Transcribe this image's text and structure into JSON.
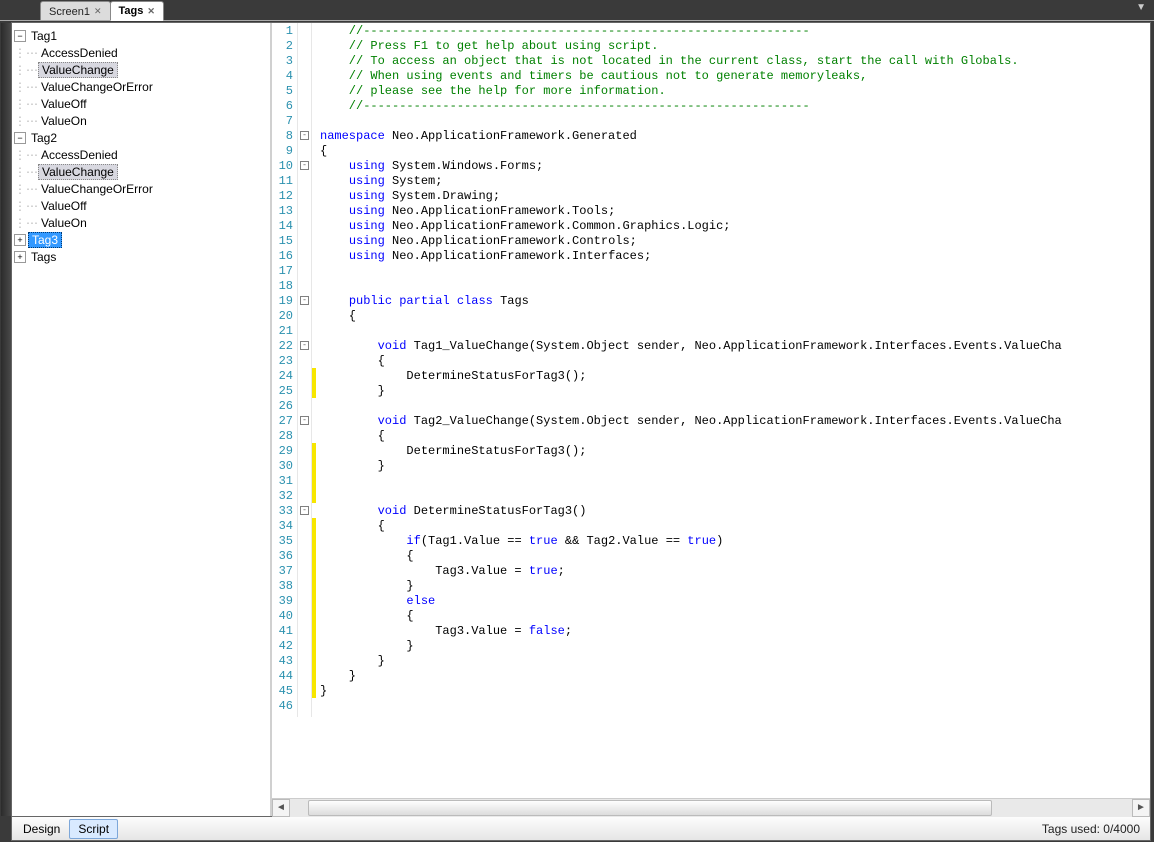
{
  "doc_tabs": {
    "inactive": "Screen1",
    "active": "Tags"
  },
  "tree": {
    "tag1": {
      "name": "Tag1",
      "children": [
        "AccessDenied",
        "ValueChange",
        "ValueChangeOrError",
        "ValueOff",
        "ValueOn"
      ]
    },
    "tag2": {
      "name": "Tag2",
      "children": [
        "AccessDenied",
        "ValueChange",
        "ValueChangeOrError",
        "ValueOff",
        "ValueOn"
      ]
    },
    "tag3": {
      "name": "Tag3"
    },
    "tags": {
      "name": "Tags"
    }
  },
  "bottom": {
    "design": "Design",
    "script": "Script",
    "status": "Tags used: 0/4000"
  },
  "code": {
    "lines": [
      {
        "n": 1,
        "cls": "cm",
        "text": "    //--------------------------------------------------------------"
      },
      {
        "n": 2,
        "cls": "cm",
        "text": "    // Press F1 to get help about using script."
      },
      {
        "n": 3,
        "cls": "cm",
        "text": "    // To access an object that is not located in the current class, start the call with Globals."
      },
      {
        "n": 4,
        "cls": "cm",
        "text": "    // When using events and timers be cautious not to generate memoryleaks,"
      },
      {
        "n": 5,
        "cls": "cm",
        "text": "    // please see the help for more information."
      },
      {
        "n": 6,
        "cls": "cm",
        "text": "    //--------------------------------------------------------------"
      },
      {
        "n": 7,
        "cls": "",
        "text": ""
      },
      {
        "n": 8,
        "cls": "",
        "html": "<span class=kw>namespace</span> Neo.ApplicationFramework.Generated",
        "fold": true
      },
      {
        "n": 9,
        "cls": "",
        "text": "{"
      },
      {
        "n": 10,
        "cls": "",
        "html": "    <span class=kw>using</span> System.Windows.Forms;",
        "fold": true
      },
      {
        "n": 11,
        "cls": "",
        "html": "    <span class=kw>using</span> System;"
      },
      {
        "n": 12,
        "cls": "",
        "html": "    <span class=kw>using</span> System.Drawing;"
      },
      {
        "n": 13,
        "cls": "",
        "html": "    <span class=kw>using</span> Neo.ApplicationFramework.Tools;"
      },
      {
        "n": 14,
        "cls": "",
        "html": "    <span class=kw>using</span> Neo.ApplicationFramework.Common.Graphics.Logic;"
      },
      {
        "n": 15,
        "cls": "",
        "html": "    <span class=kw>using</span> Neo.ApplicationFramework.Controls;"
      },
      {
        "n": 16,
        "cls": "",
        "html": "    <span class=kw>using</span> Neo.ApplicationFramework.Interfaces;"
      },
      {
        "n": 17,
        "cls": "",
        "text": ""
      },
      {
        "n": 18,
        "cls": "",
        "text": ""
      },
      {
        "n": 19,
        "cls": "",
        "html": "    <span class=kw>public</span> <span class=kw>partial</span> <span class=kw>class</span> Tags",
        "fold": true
      },
      {
        "n": 20,
        "cls": "",
        "text": "    {"
      },
      {
        "n": 21,
        "cls": "",
        "text": ""
      },
      {
        "n": 22,
        "cls": "",
        "html": "        <span class=kw>void</span> Tag1_ValueChange(System.Object sender, Neo.ApplicationFramework.Interfaces.Events.ValueCha",
        "fold": true
      },
      {
        "n": 23,
        "cls": "",
        "text": "        {"
      },
      {
        "n": 24,
        "cls": "",
        "text": "            DetermineStatusForTag3();",
        "mark": true
      },
      {
        "n": 25,
        "cls": "",
        "text": "        }",
        "mark": true
      },
      {
        "n": 26,
        "cls": "",
        "text": ""
      },
      {
        "n": 27,
        "cls": "",
        "html": "        <span class=kw>void</span> Tag2_ValueChange(System.Object sender, Neo.ApplicationFramework.Interfaces.Events.ValueCha",
        "fold": true
      },
      {
        "n": 28,
        "cls": "",
        "text": "        {"
      },
      {
        "n": 29,
        "cls": "",
        "text": "            DetermineStatusForTag3();",
        "mark": true
      },
      {
        "n": 30,
        "cls": "",
        "text": "        }",
        "mark": true
      },
      {
        "n": 31,
        "cls": "",
        "text": "",
        "mark": true
      },
      {
        "n": 32,
        "cls": "",
        "text": "",
        "mark": true
      },
      {
        "n": 33,
        "cls": "",
        "html": "        <span class=kw>void</span> DetermineStatusForTag3()",
        "fold": true
      },
      {
        "n": 34,
        "cls": "",
        "text": "        {",
        "mark": true
      },
      {
        "n": 35,
        "cls": "",
        "html": "            <span class=kw>if</span>(Tag1.Value == <span class=kw>true</span> && Tag2.Value == <span class=kw>true</span>)",
        "mark": true
      },
      {
        "n": 36,
        "cls": "",
        "text": "            {",
        "mark": true
      },
      {
        "n": 37,
        "cls": "",
        "html": "                Tag3.Value = <span class=kw>true</span>;",
        "mark": true
      },
      {
        "n": 38,
        "cls": "",
        "text": "            }",
        "mark": true
      },
      {
        "n": 39,
        "cls": "",
        "html": "            <span class=kw>else</span>",
        "mark": true
      },
      {
        "n": 40,
        "cls": "",
        "text": "            {",
        "mark": true
      },
      {
        "n": 41,
        "cls": "",
        "html": "                Tag3.Value = <span class=kw>false</span>;",
        "mark": true
      },
      {
        "n": 42,
        "cls": "",
        "text": "            }",
        "mark": true
      },
      {
        "n": 43,
        "cls": "",
        "text": "        }",
        "mark": true
      },
      {
        "n": 44,
        "cls": "",
        "text": "    }",
        "mark": true
      },
      {
        "n": 45,
        "cls": "",
        "text": "}",
        "mark": true
      },
      {
        "n": 46,
        "cls": "",
        "text": ""
      }
    ]
  }
}
